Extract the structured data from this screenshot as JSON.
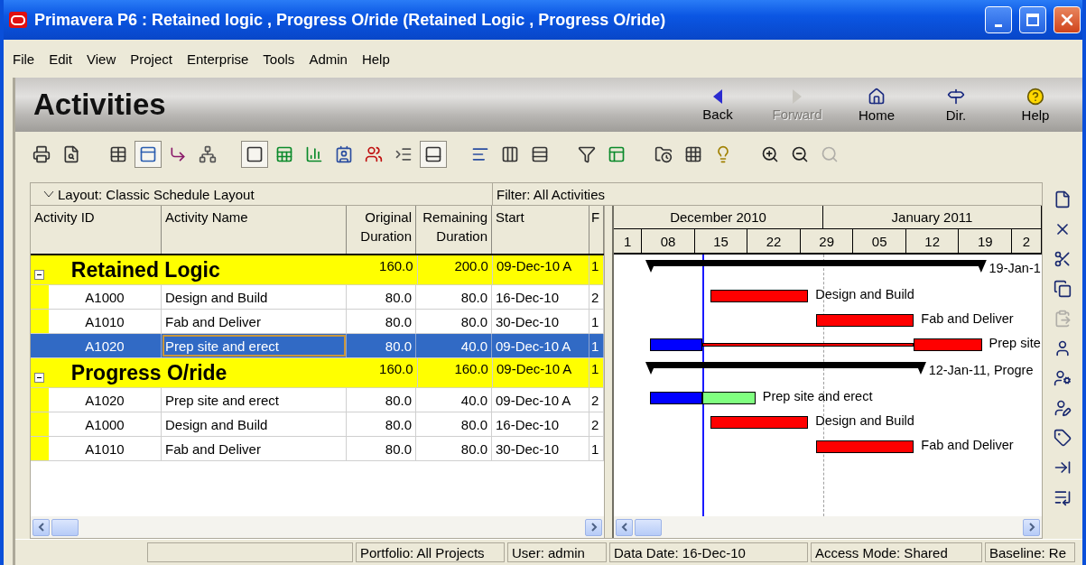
{
  "window": {
    "title": "Primavera P6 : Retained logic , Progress O/ride (Retained Logic , Progress O/ride)"
  },
  "menu": [
    "File",
    "Edit",
    "View",
    "Project",
    "Enterprise",
    "Tools",
    "Admin",
    "Help"
  ],
  "header": {
    "title": "Activities",
    "nav": [
      {
        "label": "Back",
        "disabled": false
      },
      {
        "label": "Forward",
        "disabled": true
      },
      {
        "label": "Home",
        "disabled": false
      },
      {
        "label": "Dir.",
        "disabled": false
      },
      {
        "label": "Help",
        "disabled": false
      }
    ]
  },
  "toolbar": [
    [
      {
        "pressed": false,
        "disabled": false
      },
      {
        "pressed": false,
        "disabled": false
      }
    ],
    [
      {
        "pressed": false,
        "disabled": false
      },
      {
        "pressed": true,
        "disabled": false
      },
      {
        "pressed": false,
        "disabled": false
      },
      {
        "pressed": false,
        "disabled": false
      }
    ],
    [
      {
        "pressed": true,
        "disabled": false
      },
      {
        "pressed": false,
        "disabled": false
      },
      {
        "pressed": false,
        "disabled": false
      },
      {
        "pressed": false,
        "disabled": false
      },
      {
        "pressed": false,
        "disabled": false
      },
      {
        "pressed": false,
        "disabled": false
      },
      {
        "pressed": true,
        "disabled": false
      }
    ],
    [
      {
        "pressed": false,
        "disabled": false
      },
      {
        "pressed": false,
        "disabled": false
      },
      {
        "pressed": false,
        "disabled": false
      }
    ],
    [
      {
        "pressed": false,
        "disabled": false
      },
      {
        "pressed": false,
        "disabled": false
      }
    ],
    [
      {
        "pressed": false,
        "disabled": false
      },
      {
        "pressed": false,
        "disabled": false
      },
      {
        "pressed": false,
        "disabled": false
      }
    ],
    [
      {
        "pressed": false,
        "disabled": false
      },
      {
        "pressed": false,
        "disabled": false
      },
      {
        "pressed": false,
        "disabled": true
      }
    ]
  ],
  "side_toolbar": [
    {
      "disabled": false
    },
    {
      "disabled": false
    },
    {
      "disabled": false
    },
    {
      "disabled": false
    },
    {
      "disabled": true
    },
    {
      "disabled": false
    },
    {
      "disabled": false
    },
    {
      "disabled": false
    },
    {
      "disabled": false
    },
    {
      "disabled": false
    },
    {
      "disabled": false
    }
  ],
  "layout_bar": {
    "layout": "Layout: Classic Schedule Layout",
    "filter": "Filter: All Activities"
  },
  "table": {
    "columns": [
      [
        "Activity ID"
      ],
      [
        "Activity Name"
      ],
      [
        "Original",
        "Duration"
      ],
      [
        "Remaining",
        "Duration"
      ],
      [
        "Start"
      ],
      [
        "F"
      ]
    ],
    "groups": [
      {
        "name": "Retained Logic",
        "expanded": true,
        "cells": [
          "160.0",
          "200.0",
          "09-Dec-10 A",
          "1"
        ],
        "rows": [
          {
            "id": "A1000",
            "name": "Design and Build",
            "original": "80.0",
            "remaining": "80.0",
            "start": "16-Dec-10",
            "column_6": "2",
            "selected": false
          },
          {
            "id": "A1010",
            "name": "Fab and Deliver",
            "original": "80.0",
            "remaining": "80.0",
            "start": "30-Dec-10",
            "column_6": "1",
            "selected": false
          },
          {
            "id": "A1020",
            "name": "Prep site and erect",
            "original": "80.0",
            "remaining": "40.0",
            "start": "09-Dec-10 A",
            "column_6": "1",
            "selected": true
          }
        ]
      },
      {
        "name": "Progress O/ride",
        "expanded": true,
        "cells": [
          "160.0",
          "160.0",
          "09-Dec-10 A",
          "1"
        ],
        "rows": [
          {
            "id": "A1020",
            "name": "Prep site and erect",
            "original": "80.0",
            "remaining": "40.0",
            "start": "09-Dec-10 A",
            "column_6": "2",
            "selected": false
          },
          {
            "id": "A1000",
            "name": "Design and Build",
            "original": "80.0",
            "remaining": "80.0",
            "start": "16-Dec-10",
            "column_6": "2",
            "selected": false
          },
          {
            "id": "A1010",
            "name": "Fab and Deliver",
            "original": "80.0",
            "remaining": "80.0",
            "start": "30-Dec-10",
            "column_6": "1",
            "selected": false
          }
        ]
      }
    ]
  },
  "gantt": {
    "months": [
      "December 2010",
      "January 2011"
    ],
    "weeks": [
      "1",
      "08",
      "15",
      "22",
      "29",
      "05",
      "12",
      "19",
      "2"
    ],
    "groups": [
      {
        "summary": "19-Jan-1",
        "rows": [
          {
            "label": "Design and Build",
            "segments": [
              {
                "kind": "critical"
              }
            ]
          },
          {
            "label": "Fab and Deliver",
            "segments": [
              {
                "kind": "critical"
              }
            ]
          },
          {
            "label": "Prep site",
            "segments": [
              {
                "kind": "actual"
              },
              {
                "kind": "connector"
              },
              {
                "kind": "critical"
              }
            ]
          }
        ]
      },
      {
        "summary": "12-Jan-11, Progre",
        "rows": [
          {
            "label": "Prep site and erect",
            "segments": [
              {
                "kind": "actual"
              },
              {
                "kind": "noncritical"
              }
            ]
          },
          {
            "label": "Design and Build",
            "segments": [
              {
                "kind": "critical"
              }
            ]
          },
          {
            "label": "Fab and Deliver",
            "segments": [
              {
                "kind": "critical"
              }
            ]
          }
        ]
      }
    ]
  },
  "status_bar": [
    "Portfolio: All Projects",
    "User: admin",
    "Data Date: 16-Dec-10",
    "Access Mode: Shared",
    "Baseline: Re"
  ]
}
